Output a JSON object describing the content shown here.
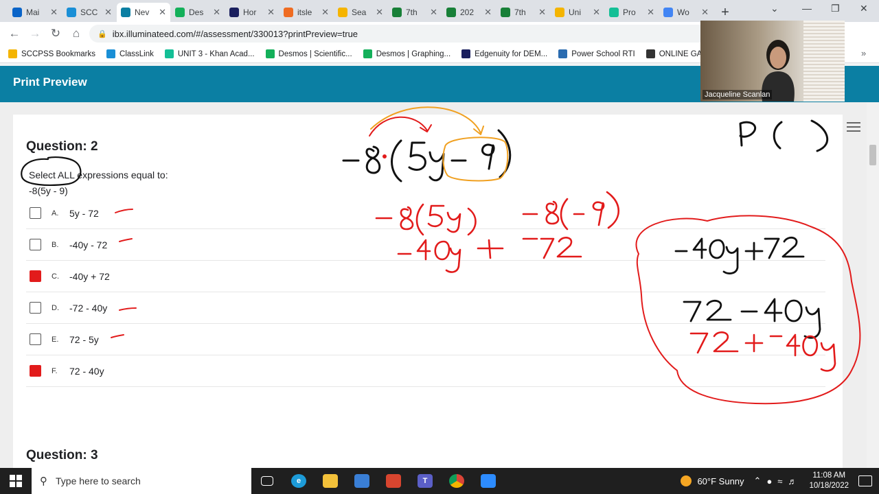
{
  "browser": {
    "tabs": [
      {
        "title": "Mai",
        "icon": "outlook-icon",
        "color": "#0a64c8"
      },
      {
        "title": "SCC",
        "icon": "classlink-icon",
        "color": "#1a8fd6"
      },
      {
        "title": "Nev",
        "icon": "illuminate-icon",
        "color": "#0b7fa3"
      },
      {
        "title": "Des",
        "icon": "desmos-icon",
        "color": "#14b05a"
      },
      {
        "title": "Hor",
        "icon": "edgenuity-icon",
        "color": "#1a1f5e"
      },
      {
        "title": "itsle",
        "icon": "itslearning-icon",
        "color": "#ef6c22"
      },
      {
        "title": "Sea",
        "icon": "google-drive-icon",
        "color": "#f5b400"
      },
      {
        "title": "7th",
        "icon": "google-sheets-icon",
        "color": "#188038"
      },
      {
        "title": "202",
        "icon": "google-sheets-icon",
        "color": "#188038"
      },
      {
        "title": "7th",
        "icon": "google-sheets-icon",
        "color": "#188038"
      },
      {
        "title": "Uni",
        "icon": "google-slides-icon",
        "color": "#f4b400"
      },
      {
        "title": "Pro",
        "icon": "khan-academy-icon",
        "color": "#14bf96"
      },
      {
        "title": "Wo",
        "icon": "google-docs-icon",
        "color": "#4285f4"
      }
    ],
    "active_tab_index": 2,
    "url": "ibx.illuminateed.com/#/assessment/330013?printPreview=true",
    "bookmarks": [
      {
        "label": "SCCPSS Bookmarks",
        "color": "#f4b400"
      },
      {
        "label": "ClassLink",
        "color": "#1a8fd6"
      },
      {
        "label": "UNIT 3 - Khan Acad...",
        "color": "#14bf96"
      },
      {
        "label": "Desmos | Scientific...",
        "color": "#14b05a"
      },
      {
        "label": "Desmos | Graphing...",
        "color": "#14b05a"
      },
      {
        "label": "Edgenuity for DEM...",
        "color": "#1a1f5e"
      },
      {
        "label": "Power School RTI",
        "color": "#2b6cb0"
      },
      {
        "label": "ONLINE GAME R",
        "color": "#333333"
      }
    ]
  },
  "app": {
    "header_title": "Print Preview"
  },
  "question2": {
    "heading": "Question: 2",
    "prompt": "Select ALL expressions equal to:",
    "expression": "-8(5y - 9)",
    "options": [
      {
        "letter": "A.",
        "text": "5y - 72",
        "scribbled": false
      },
      {
        "letter": "B.",
        "text": "-40y - 72",
        "scribbled": false
      },
      {
        "letter": "C.",
        "text": "-40y + 72",
        "scribbled": true
      },
      {
        "letter": "D.",
        "text": "-72 - 40y",
        "scribbled": false
      },
      {
        "letter": "E.",
        "text": "72 - 5y",
        "scribbled": false
      },
      {
        "letter": "F.",
        "text": "72 - 40y",
        "scribbled": true
      }
    ]
  },
  "question3": {
    "heading": "Question: 3"
  },
  "video": {
    "participant_name": "Jacqueline Scanlan"
  },
  "taskbar": {
    "search_placeholder": "Type here to search",
    "weather": "60°F  Sunny",
    "time": "11:08 AM",
    "date": "10/18/2022"
  },
  "colors": {
    "header": "#0b7fa3",
    "ink_red": "#e21b1b",
    "ink_orange": "#f0a020",
    "ink_black": "#111111"
  }
}
